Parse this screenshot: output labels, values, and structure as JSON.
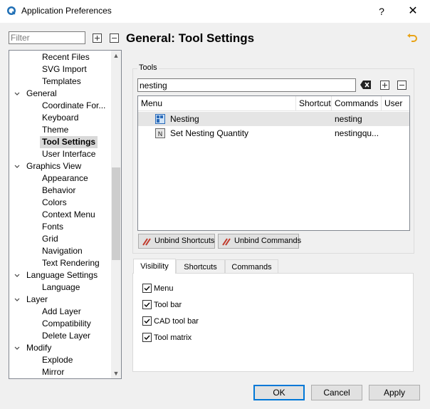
{
  "window": {
    "title": "Application Preferences",
    "help_glyph": "?",
    "close_glyph": "✕"
  },
  "filter": {
    "placeholder": "Filter",
    "value": ""
  },
  "tree": {
    "items": [
      {
        "label": "Recent Files",
        "level": 1
      },
      {
        "label": "SVG Import",
        "level": 1
      },
      {
        "label": "Templates",
        "level": 1
      },
      {
        "label": "General",
        "level": 0,
        "expanded": true
      },
      {
        "label": "Coordinate For...",
        "level": 1
      },
      {
        "label": "Keyboard",
        "level": 1
      },
      {
        "label": "Theme",
        "level": 1
      },
      {
        "label": "Tool Settings",
        "level": 1,
        "selected": true
      },
      {
        "label": "User Interface",
        "level": 1
      },
      {
        "label": "Graphics View",
        "level": 0,
        "expanded": true
      },
      {
        "label": "Appearance",
        "level": 1
      },
      {
        "label": "Behavior",
        "level": 1
      },
      {
        "label": "Colors",
        "level": 1
      },
      {
        "label": "Context Menu",
        "level": 1
      },
      {
        "label": "Fonts",
        "level": 1
      },
      {
        "label": "Grid",
        "level": 1
      },
      {
        "label": "Navigation",
        "level": 1
      },
      {
        "label": "Text Rendering",
        "level": 1
      },
      {
        "label": "Language Settings",
        "level": 0,
        "expanded": true
      },
      {
        "label": "Language",
        "level": 1
      },
      {
        "label": "Layer",
        "level": 0,
        "expanded": true
      },
      {
        "label": "Add Layer",
        "level": 1
      },
      {
        "label": "Compatibility",
        "level": 1
      },
      {
        "label": "Delete Layer",
        "level": 1
      },
      {
        "label": "Modify",
        "level": 0,
        "expanded": true
      },
      {
        "label": "Explode",
        "level": 1
      },
      {
        "label": "Mirror",
        "level": 1
      }
    ]
  },
  "page": {
    "title": "General: Tool Settings"
  },
  "tools": {
    "group_label": "Tools",
    "search_value": "nesting",
    "columns": [
      "Menu",
      "Shortcut",
      "Commands",
      "User"
    ],
    "rows": [
      {
        "menu": "Nesting",
        "shortcut": "",
        "commands": "nesting",
        "user": "",
        "selected": true,
        "icon": "nesting-icon"
      },
      {
        "menu": "Set Nesting Quantity",
        "shortcut": "",
        "commands": "nestingqu...",
        "user": "",
        "selected": false,
        "icon": "nesting-quantity-icon"
      }
    ],
    "unbind_shortcuts_label": "Unbind Shortcuts",
    "unbind_commands_label": "Unbind Commands"
  },
  "tabs": [
    {
      "label": "Visibility",
      "active": true
    },
    {
      "label": "Shortcuts",
      "active": false
    },
    {
      "label": "Commands",
      "active": false
    }
  ],
  "visibility": {
    "options": [
      {
        "label": "Menu",
        "checked": true
      },
      {
        "label": "Tool bar",
        "checked": true
      },
      {
        "label": "CAD tool bar",
        "checked": true
      },
      {
        "label": "Tool matrix",
        "checked": true
      }
    ]
  },
  "footer": {
    "ok_label": "OK",
    "cancel_label": "Cancel",
    "apply_label": "Apply"
  },
  "colors": {
    "accent": "#0078d7",
    "selection": "#d9d9d9",
    "undo_icon": "#e8a317",
    "unbind_icon": "#c0392b"
  }
}
